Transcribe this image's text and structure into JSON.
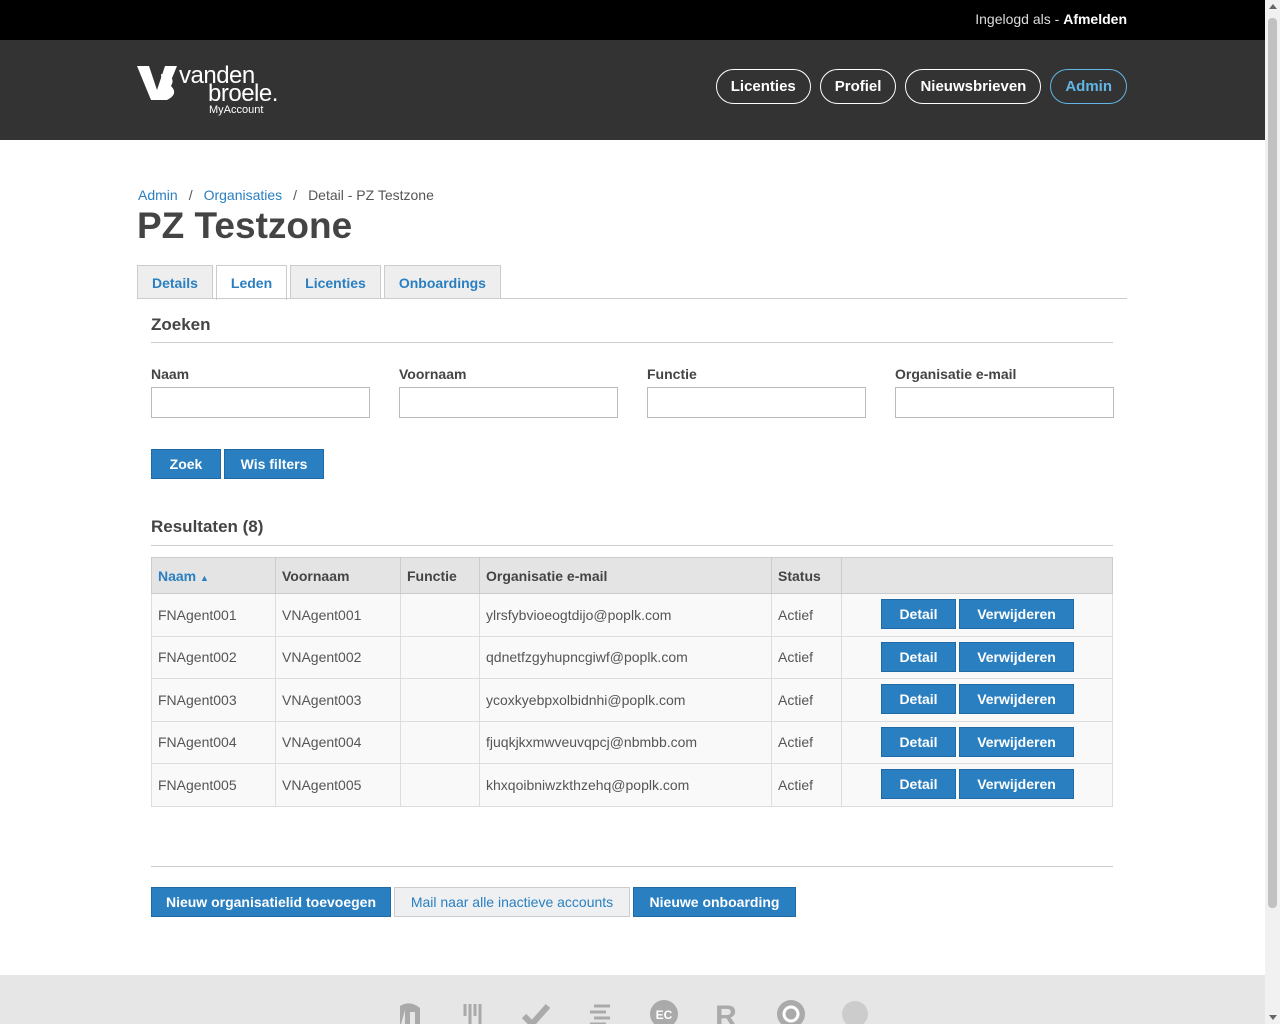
{
  "topbar": {
    "logged_in_prefix": "Ingelogd als -",
    "logout": "Afmelden"
  },
  "logo": {
    "word1": "vanden",
    "word2": "broele.",
    "sub": "MyAccount"
  },
  "nav": [
    "Licenties",
    "Profiel",
    "Nieuwsbrieven",
    "Admin"
  ],
  "breadcrumb": {
    "admin": "Admin",
    "organisaties": "Organisaties",
    "current": "Detail - PZ Testzone",
    "sep": "/"
  },
  "page_title": "PZ Testzone",
  "tabs": [
    "Details",
    "Leden",
    "Licenties",
    "Onboardings"
  ],
  "search": {
    "heading": "Zoeken",
    "fields": [
      "Naam",
      "Voornaam",
      "Functie",
      "Organisatie e-mail"
    ],
    "zoek": "Zoek",
    "wis": "Wis filters"
  },
  "results": {
    "heading": "Resultaten (8)",
    "columns": [
      "Naam",
      "Voornaam",
      "Functie",
      "Organisatie e-mail",
      "Status"
    ],
    "sort_indicator": "▲",
    "detail_label": "Detail",
    "delete_label": "Verwijderen",
    "rows": [
      {
        "naam": "FNAgent001",
        "voornaam": "VNAgent001",
        "functie": "",
        "email": "ylrsfybvioeogtdijo@poplk.com",
        "status": "Actief"
      },
      {
        "naam": "FNAgent002",
        "voornaam": "VNAgent002",
        "functie": "",
        "email": "qdnetfzgyhupncgiwf@poplk.com",
        "status": "Actief"
      },
      {
        "naam": "FNAgent003",
        "voornaam": "VNAgent003",
        "functie": "",
        "email": "ycoxkyebpxolbidnhi@poplk.com",
        "status": "Actief"
      },
      {
        "naam": "FNAgent004",
        "voornaam": "VNAgent004",
        "functie": "",
        "email": "fjuqkjkxmwveuvqpcj@nbmbb.com",
        "status": "Actief"
      },
      {
        "naam": "FNAgent005",
        "voornaam": "VNAgent005",
        "functie": "",
        "email": "khxqoibniwzkthzehq@poplk.com",
        "status": "Actief"
      }
    ]
  },
  "actions": {
    "add_member": "Nieuw organisatielid toevoegen",
    "mail_inactive": "Mail naar alle inactieve accounts",
    "new_onboarding": "Nieuwe onboarding"
  },
  "footer_icons": [
    "brand-logo-1-icon",
    "brand-logo-2-icon",
    "brand-logo-3-icon",
    "brand-logo-4-icon",
    "ec-icon",
    "r-icon",
    "brand-logo-7-icon",
    "brand-logo-8-icon"
  ],
  "colors": {
    "accent": "#2a7fc1",
    "admin_pill": "#61b6e5",
    "header": "#333333"
  }
}
